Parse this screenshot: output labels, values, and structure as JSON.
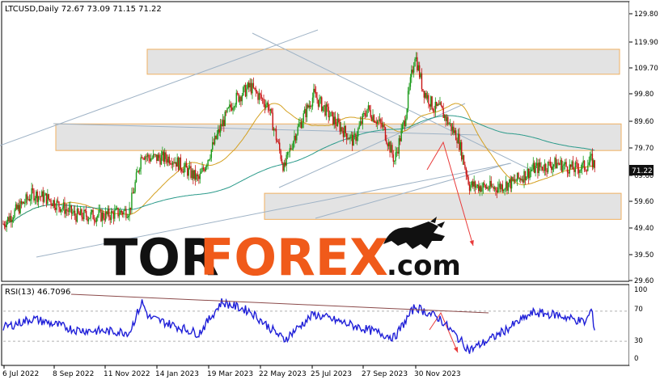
{
  "header": {
    "symbol_line": "LTCUSD,Daily  72.67 73.09 71.15 71.22"
  },
  "watermark": {
    "part1": "TOR",
    "part2": "FOREX",
    "part3": ".com",
    "color_dark": "#111111",
    "color_accent": "#f05a1a"
  },
  "colors": {
    "bull": "#1a9a1a",
    "bear": "#c81414",
    "ma_fast": "#d4a020",
    "ma_slow": "#2a9a8a",
    "channel": "#9fb3c6",
    "zone_fill": "#e3e3e3",
    "zone_border": "#f0b060",
    "arrow": "#e83a3a",
    "rsi_line": "#1f1fd8",
    "rsi_trend": "#8b4a4a",
    "price_tag_bg": "#111111"
  },
  "chart_data": [
    {
      "type": "candlestick",
      "title": "LTCUSD,Daily",
      "last_price": "71.22",
      "ylim": [
        29.6,
        129.8
      ],
      "y_ticks": [
        "129.80",
        "119.90",
        "109.70",
        "99.80",
        "89.60",
        "79.70",
        "69.60",
        "59.60",
        "49.40",
        "39.50",
        "29.60"
      ],
      "x_ticks": [
        "6 Jul 2022",
        "8 Sep 2022",
        "11 Nov 2022",
        "14 Jan 2023",
        "19 Mar 2023",
        "22 May 2023",
        "25 Jul 2023",
        "27 Sep 2023",
        "30 Nov 2023"
      ],
      "series_anchors": [
        [
          "6 Jul 2022",
          50
        ],
        [
          "1 Aug 2022",
          61
        ],
        [
          "15 Aug 2022",
          59
        ],
        [
          "8 Sep 2022",
          53
        ],
        [
          "5 Oct 2022",
          53
        ],
        [
          "25 Oct 2022",
          55
        ],
        [
          "5 Nov 2022",
          76
        ],
        [
          "11 Nov 2022",
          74
        ],
        [
          "1 Dec 2022",
          74
        ],
        [
          "25 Dec 2022",
          66
        ],
        [
          "14 Jan 2023",
          86
        ],
        [
          "25 Jan 2023",
          95
        ],
        [
          "8 Feb 2023",
          100
        ],
        [
          "24 Feb 2023",
          93
        ],
        [
          "10 Mar 2023",
          70
        ],
        [
          "19 Mar 2023",
          82
        ],
        [
          "5 Apr 2023",
          97
        ],
        [
          "20 Apr 2023",
          89
        ],
        [
          "10 May 2023",
          80
        ],
        [
          "22 May 2023",
          92
        ],
        [
          "5 Jun 2023",
          85
        ],
        [
          "15 Jun 2023",
          73
        ],
        [
          "24 Jun 2023",
          88
        ],
        [
          "3 Jul 2023",
          112
        ],
        [
          "10 Jul 2023",
          99
        ],
        [
          "20 Jul 2023",
          92
        ],
        [
          "25 Jul 2023",
          92
        ],
        [
          "10 Aug 2023",
          81
        ],
        [
          "20 Aug 2023",
          64
        ],
        [
          "10 Sep 2023",
          63
        ],
        [
          "27 Sep 2023",
          65
        ],
        [
          "15 Oct 2023",
          70
        ],
        [
          "5 Nov 2023",
          72
        ],
        [
          "20 Nov 2023",
          70
        ],
        [
          "30 Nov 2023",
          71
        ],
        [
          "5 Dec 2023",
          73.09
        ],
        [
          "8 Dec 2023",
          71.22
        ]
      ],
      "zones": [
        {
          "from": 104.5,
          "to": 113.6
        },
        {
          "from": 76.7,
          "to": 86.4
        },
        {
          "from": 51.6,
          "to": 61.1
        }
      ]
    },
    {
      "type": "line",
      "title": "RSI(13) 46.7096",
      "ylim": [
        0,
        100
      ],
      "y_ticks": [
        "100",
        "70",
        "30",
        "0"
      ],
      "levels": [
        70,
        30
      ],
      "series_anchors": [
        [
          "6 Jul 2022",
          48
        ],
        [
          "1 Aug 2022",
          60
        ],
        [
          "8 Sep 2022",
          45
        ],
        [
          "25 Oct 2022",
          42
        ],
        [
          "5 Nov 2022",
          82
        ],
        [
          "11 Nov 2022",
          62
        ],
        [
          "25 Dec 2022",
          40
        ],
        [
          "14 Jan 2023",
          82
        ],
        [
          "8 Feb 2023",
          70
        ],
        [
          "10 Mar 2023",
          32
        ],
        [
          "5 Apr 2023",
          66
        ],
        [
          "15 Jun 2023",
          35
        ],
        [
          "3 Jul 2023",
          76
        ],
        [
          "25 Jul 2023",
          60
        ],
        [
          "20 Aug 2023",
          18
        ],
        [
          "10 Sep 2023",
          35
        ],
        [
          "15 Oct 2023",
          68
        ],
        [
          "5 Nov 2023",
          65
        ],
        [
          "30 Nov 2023",
          55
        ],
        [
          "5 Dec 2023",
          72
        ],
        [
          "8 Dec 2023",
          46.7
        ]
      ]
    }
  ]
}
